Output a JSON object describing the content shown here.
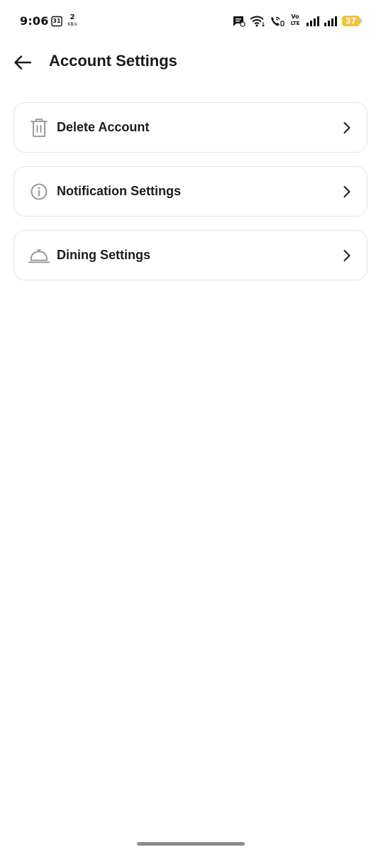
{
  "status_bar": {
    "time": "9:06",
    "calendar_day": "31",
    "net_speed_value": "2",
    "net_speed_unit": "KB/s",
    "volte_top": "Vo",
    "volte_bottom": "LTE",
    "battery_level": "37",
    "battery_color": "#f2c33a"
  },
  "header": {
    "title": "Account Settings",
    "back_icon": "arrow-left-icon"
  },
  "settings": {
    "items": [
      {
        "label": "Delete Account",
        "icon": "trash-icon"
      },
      {
        "label": "Notification Settings",
        "icon": "info-icon"
      },
      {
        "label": "Dining Settings",
        "icon": "cloche-icon"
      }
    ],
    "chevron_icon": "chevron-right-icon"
  },
  "colors": {
    "icon_gray": "#8e8e8e",
    "text_dark": "#1c1c1c",
    "card_border": "#e6e6e6"
  }
}
